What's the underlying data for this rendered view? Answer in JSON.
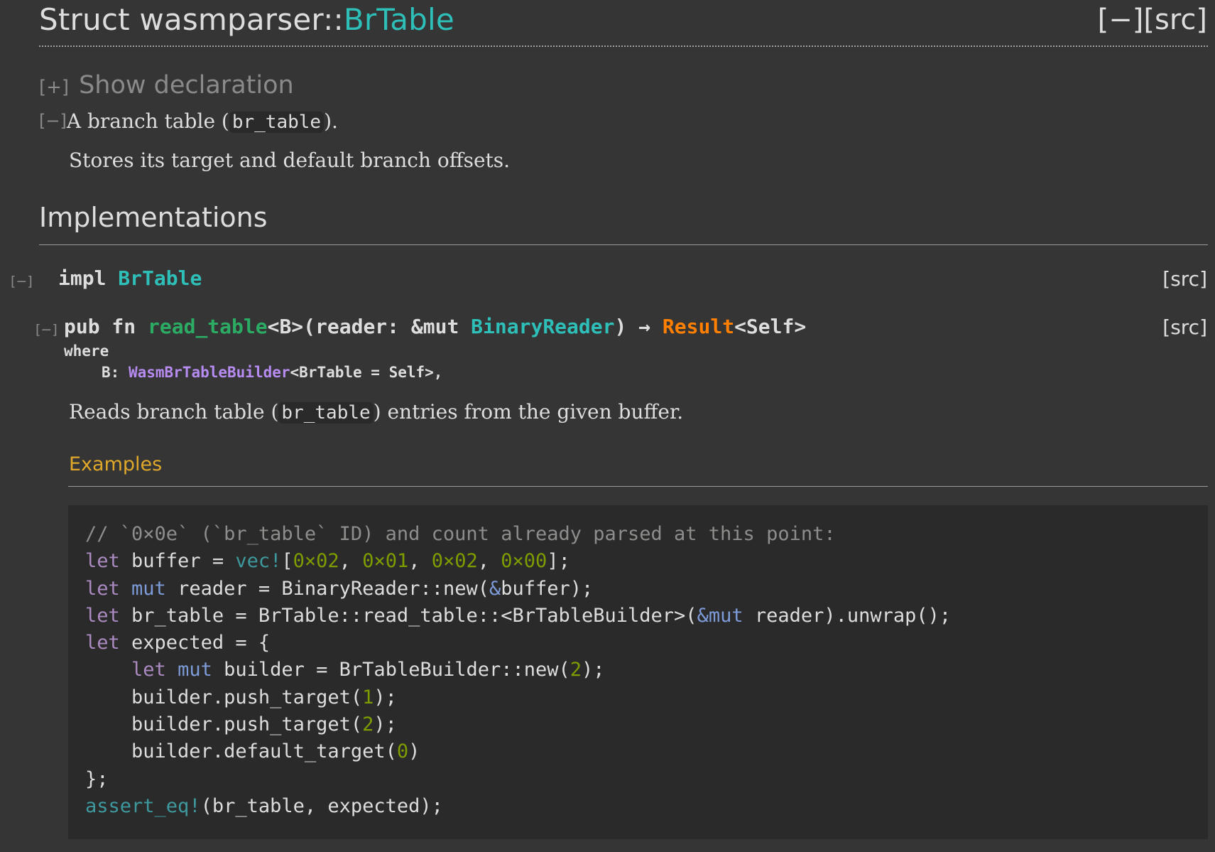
{
  "header": {
    "title_prefix": "Struct wasmparser::",
    "title_name": "BrTable",
    "collapse_all": "[−]",
    "src": "[src]"
  },
  "declaration": {
    "toggle": "[+]",
    "label": "Show declaration"
  },
  "summary": {
    "toggle": "[−]",
    "text_before": "A branch table (",
    "code": "br_table",
    "text_after": ").",
    "detail": "Stores its target and default branch offsets."
  },
  "implementations": {
    "heading": "Implementations",
    "impl": {
      "toggle": "[−]",
      "keyword": "impl",
      "type": "BrTable",
      "src": "[src]"
    },
    "method": {
      "toggle": "[−]",
      "pub_fn": "pub fn ",
      "name": "read_table",
      "generics_open": "<B>(reader: &mut ",
      "param_type": "BinaryReader",
      "arrow": ") → ",
      "return_type": "Result",
      "return_generic": "<Self>",
      "where": "where",
      "bound_prefix": "B: ",
      "bound_trait": "WasmBrTableBuilder",
      "bound_suffix": "<BrTable = Self>,",
      "src": "[src]",
      "doc_before": "Reads branch table (",
      "doc_code": "br_table",
      "doc_after": ") entries from the given buffer.",
      "examples_heading": "Examples"
    }
  },
  "example_code": {
    "line1": "// `0×0e` (`br_table` ID) and count already parsed at this point:",
    "line2": {
      "kw": "let",
      "a": " buffer = ",
      "macro": "vec!",
      "b": "[",
      "n1": "0×02",
      "c1": ", ",
      "n2": "0×01",
      "c2": ", ",
      "n3": "0×02",
      "c3": ", ",
      "n4": "0×00",
      "end": "];"
    },
    "line3": {
      "kw": "let",
      "mut": "mut",
      "a": " reader = BinaryReader::new(",
      "amp": "&",
      "b": "buffer);"
    },
    "line4": {
      "kw": "let",
      "a": " br_table = BrTable::read_table::<BrTableBuilder>(",
      "amp": "&mut",
      "b": " reader).unwrap();"
    },
    "line5": {
      "kw": "let",
      "a": " expected = {"
    },
    "line6": {
      "kw": "let",
      "mut": "mut",
      "a": " builder = BrTableBuilder::new(",
      "n": "2",
      "b": ");"
    },
    "line7": {
      "a": "builder.push_target(",
      "n": "1",
      "b": ");"
    },
    "line8": {
      "a": "builder.push_target(",
      "n": "2",
      "b": ");"
    },
    "line9": {
      "a": "builder.default_target(",
      "n": "0",
      "b": ")"
    },
    "line10": "};",
    "line11": {
      "macro": "assert_eq!",
      "a": "(br_table, expected);"
    }
  },
  "colors": {
    "background": "#353535",
    "type": "#2dbfb8",
    "function": "#2bab63",
    "result": "#ff7f00",
    "trait": "#b78cf2",
    "examples": "#e0a82a"
  }
}
